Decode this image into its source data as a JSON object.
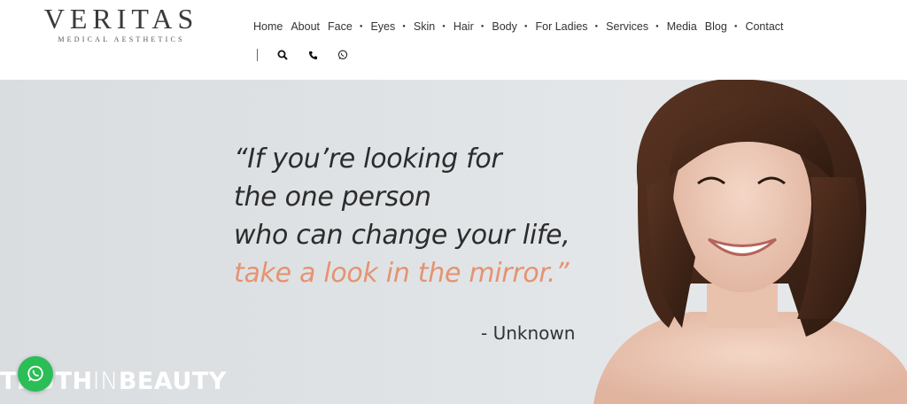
{
  "brand": {
    "name": "VERITAS",
    "subtitle": "MEDICAL AESTHETICS"
  },
  "nav": {
    "items": [
      {
        "label": "Home",
        "has_dropdown": false
      },
      {
        "label": "About",
        "has_dropdown": false
      },
      {
        "label": "Face",
        "has_dropdown": true
      },
      {
        "label": "Eyes",
        "has_dropdown": true
      },
      {
        "label": "Skin",
        "has_dropdown": true
      },
      {
        "label": "Hair",
        "has_dropdown": true
      },
      {
        "label": "Body",
        "has_dropdown": true
      },
      {
        "label": "For Ladies",
        "has_dropdown": true
      },
      {
        "label": "Services",
        "has_dropdown": true
      },
      {
        "label": "Media",
        "has_dropdown": false
      },
      {
        "label": "Blog",
        "has_dropdown": true
      },
      {
        "label": "Contact",
        "has_dropdown": false
      }
    ],
    "tools": [
      "search-icon",
      "phone-icon",
      "whatsapp-icon"
    ]
  },
  "hero": {
    "quote_lines": [
      "“If you’re looking for",
      "the one person",
      "who can change your life,"
    ],
    "quote_accent": "take a look in the mirror.”",
    "author": "- Unknown",
    "tagline": {
      "part1": "TRUTH",
      "part2": "IN",
      "part3": "BEAUTY"
    }
  },
  "colors": {
    "accent": "#e59372",
    "whatsapp": "#2bbd56",
    "text": "#2c2c2c"
  }
}
